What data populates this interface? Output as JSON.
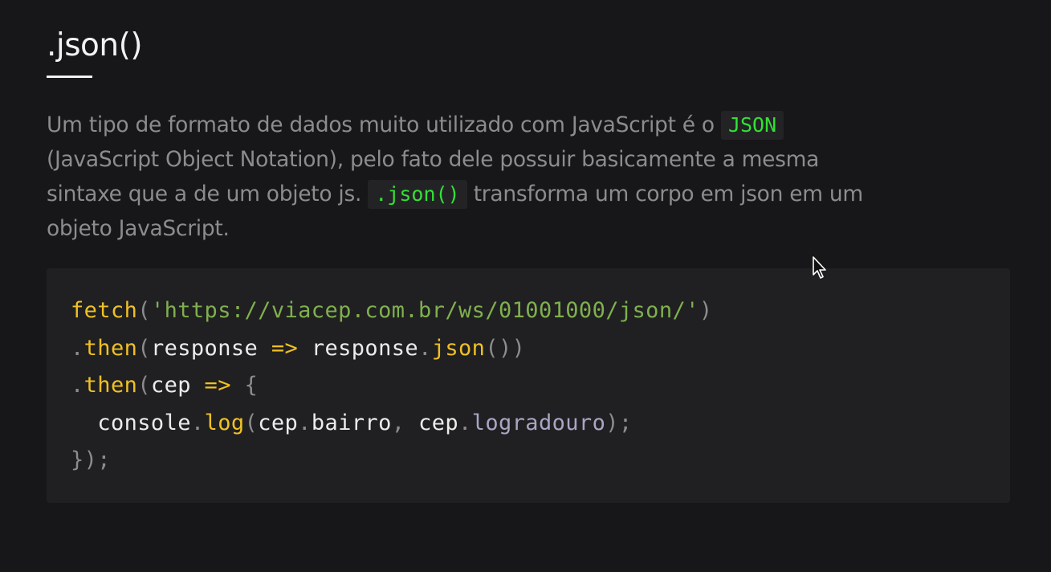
{
  "section": {
    "title": ".json()",
    "intro": {
      "part1": "Um tipo de formato de dados muito utilizado com JavaScript é o ",
      "code1": "JSON",
      "part2": " (JavaScript Object Notation), pelo fato dele possuir basicamente a mesma sintaxe que a de um objeto js. ",
      "code2": ".json()",
      "part3": " transforma um corpo em json em um objeto JavaScript."
    }
  },
  "code": {
    "l1_fn": "fetch",
    "l1_open": "(",
    "l1_str": "'https://viacep.com.br/ws/01001000/json/'",
    "l1_close": ")",
    "l2_dot": ".",
    "l2_method": "then",
    "l2_open": "(",
    "l2_param": "response",
    "l2_arrow": " => ",
    "l2_obj": "response",
    "l2_dot2": ".",
    "l2_call": "json",
    "l2_close": "())",
    "l3_dot": ".",
    "l3_method": "then",
    "l3_open": "(",
    "l3_param": "cep",
    "l3_arrow": " => ",
    "l3_brace": "{",
    "l4_indent": "  ",
    "l4_obj": "console",
    "l4_dot": ".",
    "l4_method": "log",
    "l4_open": "(",
    "l4_arg1obj": "cep",
    "l4_dot2": ".",
    "l4_arg1prop": "bairro",
    "l4_comma": ", ",
    "l4_arg2obj": "cep",
    "l4_dot3": ".",
    "l4_arg2prop": "logradouro",
    "l4_close": ");",
    "l5_close": "});"
  },
  "colors": {
    "background": "#171719",
    "code_background": "#202022",
    "inline_code": "#34e034",
    "function": "#f0c024",
    "string": "#7fb04e",
    "text_muted": "#8c8c8e",
    "heading": "#f2f2f2"
  },
  "icons": {
    "cursor": "mouse-pointer-icon"
  }
}
